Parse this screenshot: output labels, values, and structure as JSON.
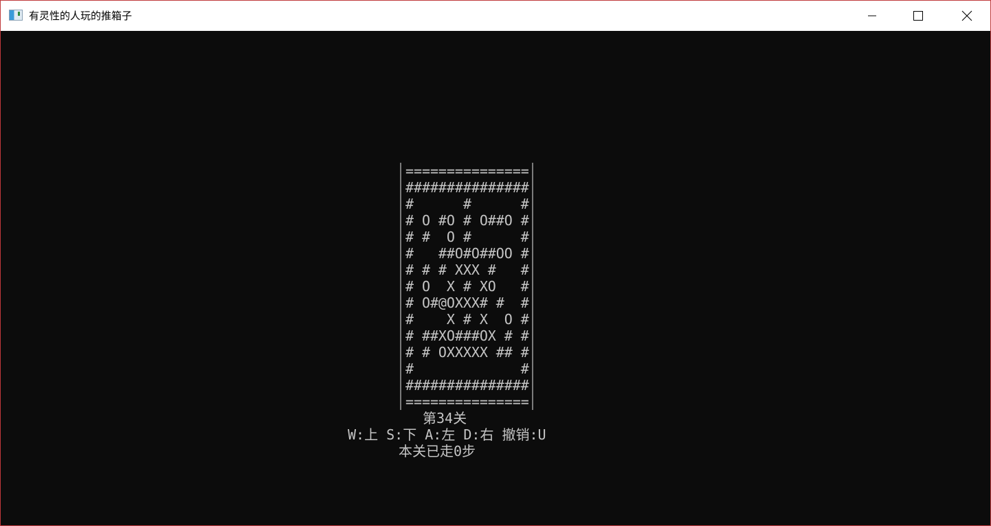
{
  "window": {
    "title": "有灵性的人玩的推箱子",
    "frame_color": "#c0393b",
    "background_color": "#0c0c0c",
    "text_color": "#c5c5c5"
  },
  "board": {
    "rows": [
      "===============",
      "###############",
      "#      #      #",
      "# O #O # O##O #",
      "# #  O #      #",
      "#   ##O#O##OO #",
      "# # # XXX #   #",
      "# O  X # XO   #",
      "# O#@OXXX# #  #",
      "#    X # X  O #",
      "# ##XO###OX # #",
      "# # OXXXXX ## #",
      "#             #",
      "###############",
      "==============="
    ]
  },
  "status": {
    "level": "第34关",
    "controls": "W:上 S:下 A:左 D:右 撤销:U",
    "steps": "本关已走0步"
  },
  "icons": {
    "app": "console-app-icon",
    "minimize": "minimize-icon",
    "maximize": "maximize-icon",
    "close": "close-icon"
  }
}
